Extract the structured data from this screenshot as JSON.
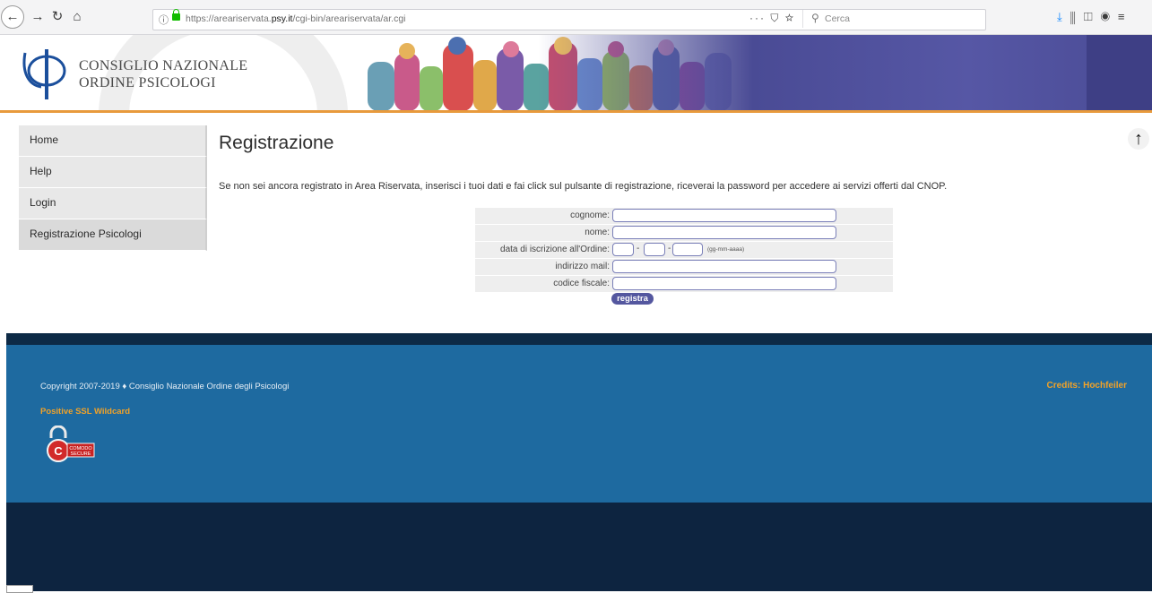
{
  "browser": {
    "url_prefix": "https://areariservata.",
    "url_domain": "psy.it",
    "url_suffix": "/cgi-bin/areariservata/ar.cgi",
    "page_actions": "··· ⛉ ☆",
    "search_placeholder": "Cerca",
    "icons": [
      "back-icon",
      "forward-icon",
      "reload-icon",
      "home-icon",
      "info-icon",
      "lock-icon",
      "page-actions-icon",
      "pocket-icon",
      "bookmark-star-icon",
      "search-icon",
      "download-icon",
      "library-icon",
      "sidebar-icon",
      "account-icon",
      "menu-icon"
    ]
  },
  "header": {
    "org_line1": "CONSIGLIO NAZIONALE",
    "org_line2": "ORDINE PSICOLOGI",
    "accent_color": "#e89a3c"
  },
  "sidebar": {
    "items": [
      {
        "label": "Home"
      },
      {
        "label": "Help"
      },
      {
        "label": "Login"
      },
      {
        "label": "Registrazione Psicologi"
      }
    ]
  },
  "main": {
    "title": "Registrazione",
    "intro": "Se non sei ancora registrato in Area Riservata, inserisci i tuoi dati e fai click sul pulsante di registrazione, riceverai la password per accedere ai servizi offerti dal CNOP.",
    "form": {
      "cognome_label": "cognome:",
      "nome_label": "nome:",
      "data_label": "data di iscrizione all'Ordine:",
      "date_sep": "-",
      "date_hint": "(gg-mm-aaaa)",
      "email_label": "indirizzo mail:",
      "cf_label": "codice fiscale:",
      "submit_label": "registra"
    }
  },
  "footer": {
    "copyright": "Copyright 2007-2019  ♦  Consiglio Nazionale Ordine degli Psicologi",
    "ssl": "Positive SSL Wildcard",
    "credits": "Credits: Hochfeiler",
    "seal_line1": "COMODO",
    "seal_line2": "SECURE",
    "colors": {
      "band": "#1e6aa0",
      "dark": "#0d2440",
      "accent": "#f2a227"
    }
  }
}
